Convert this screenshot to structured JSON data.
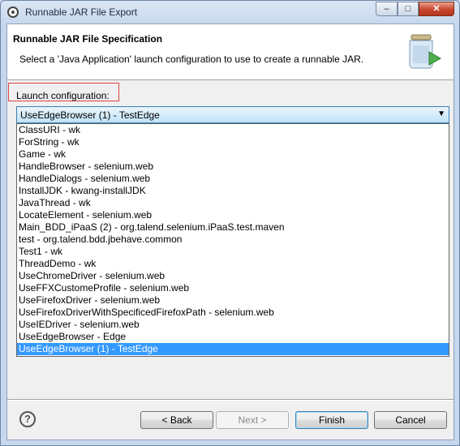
{
  "window": {
    "title": "Runnable JAR File Export",
    "controls": {
      "minimize": "–",
      "maximize": "□",
      "close": "✕"
    }
  },
  "header": {
    "title": "Runnable JAR File Specification",
    "description": "Select a 'Java Application' launch configuration to use to create a runnable JAR."
  },
  "launch_config": {
    "label": "Launch configuration:",
    "selected_value": "UseEdgeBrowser (1) - TestEdge",
    "options": [
      "ClassURI - wk",
      "ForString - wk",
      "Game - wk",
      "HandleBrowser - selenium.web",
      "HandleDialogs - selenium.web",
      "InstallJDK - kwang-installJDK",
      "JavaThread - wk",
      "LocateElement - selenium.web",
      "Main_BDD_iPaaS (2) - org.talend.selenium.iPaaS.test.maven",
      "test - org.talend.bdd.jbehave.common",
      "Test1 - wk",
      "ThreadDemo - wk",
      "UseChromeDriver - selenium.web",
      "UseFFXCustomeProfile - selenium.web",
      "UseFirefoxDriver - selenium.web",
      "UseFirefoxDriverWithSpecificedFirefoxPath - selenium.web",
      "UseIEDriver - selenium.web",
      "UseEdgeBrowser - Edge",
      "UseEdgeBrowser (1) - TestEdge"
    ],
    "selected_index": 18
  },
  "footer": {
    "help": "?",
    "back": "< Back",
    "next": "Next >",
    "finish": "Finish",
    "cancel": "Cancel"
  }
}
